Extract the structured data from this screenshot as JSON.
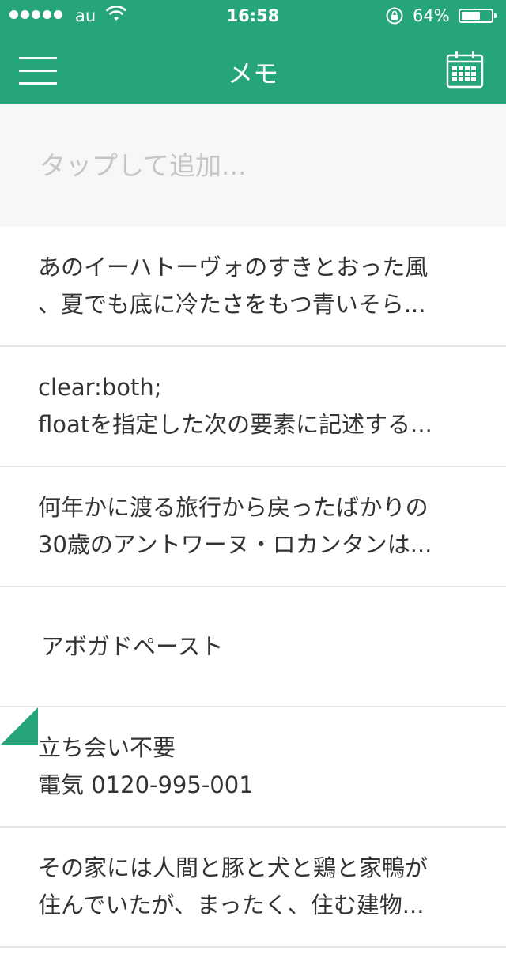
{
  "status_bar": {
    "carrier": "au",
    "time": "16:58",
    "battery_percent": "64%",
    "battery_level": 0.64,
    "icons": [
      "signal-dots-icon",
      "wifi-icon",
      "rotation-lock-icon",
      "battery-icon"
    ]
  },
  "header": {
    "title": "メモ",
    "menu_icon": "hamburger-menu-icon",
    "calendar_icon": "calendar-icon"
  },
  "add_field": {
    "placeholder": "タップして追加..."
  },
  "memos": [
    {
      "lines": [
        "あのイーハトーヴォのすきとおった風",
        "、夏でも底に冷たさをもつ青いそら..."
      ],
      "flagged": false
    },
    {
      "lines": [
        "clear:both;",
        "floatを指定した次の要素に記述する..."
      ],
      "flagged": false
    },
    {
      "lines": [
        "何年かに渡る旅行から戻ったばかりの",
        "30歳のアントワーヌ・ロカンタンは..."
      ],
      "flagged": false
    },
    {
      "lines": [
        "アボガドペースト"
      ],
      "flagged": false
    },
    {
      "lines": [
        "立ち会い不要",
        "電気 0120-995-001"
      ],
      "flagged": true
    },
    {
      "lines": [
        "その家には人間と豚と犬と鶏と家鴨が",
        "住んでいたが、まったく、住む建物..."
      ],
      "flagged": false
    }
  ],
  "colors": {
    "accent": "#27a57a",
    "add_area_bg": "#f7f7f7",
    "placeholder": "#c6c6c6",
    "text": "#333333",
    "divider": "#e6e6e6"
  }
}
